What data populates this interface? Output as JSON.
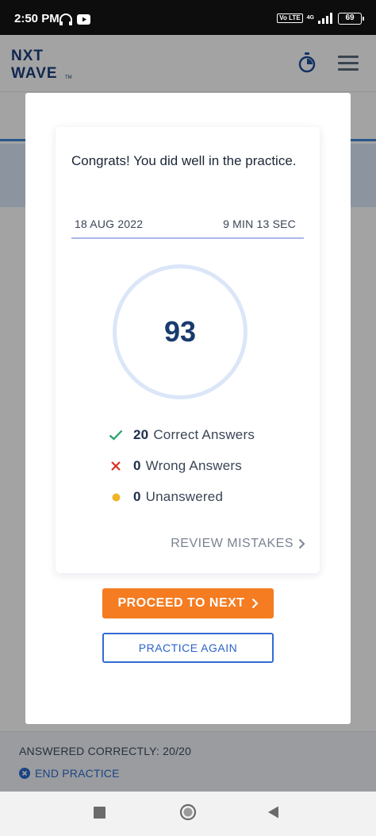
{
  "status_bar": {
    "time": "2:50 PM",
    "volte": "Vo LTE",
    "network": "4G",
    "battery": "69"
  },
  "app_header": {
    "logo_text_top": "NXT",
    "logo_text_bottom": "WAVE",
    "logo_tm": "TM"
  },
  "footer": {
    "answered_status": "ANSWERED CORRECTLY: 20/20",
    "end_practice_label": "END PRACTICE"
  },
  "modal": {
    "congrats_message": "Congrats! You did well in the practice.",
    "date": "18 AUG 2022",
    "duration": "9 MIN 13 SEC",
    "score": "93",
    "stats": {
      "correct_count": "20",
      "correct_label": "Correct Answers",
      "wrong_count": "0",
      "wrong_label": "Wrong Answers",
      "unanswered_count": "0",
      "unanswered_label": "Unanswered"
    },
    "review_mistakes_label": "REVIEW MISTAKES",
    "proceed_label": "PROCEED TO NEXT",
    "practice_again_label": "PRACTICE AGAIN"
  },
  "colors": {
    "accent_orange": "#f57c21",
    "accent_blue": "#2b63c8",
    "score_text": "#183b6e",
    "correct_green": "#22a06b",
    "wrong_red": "#d93025",
    "unanswered_yellow": "#f0b429"
  }
}
